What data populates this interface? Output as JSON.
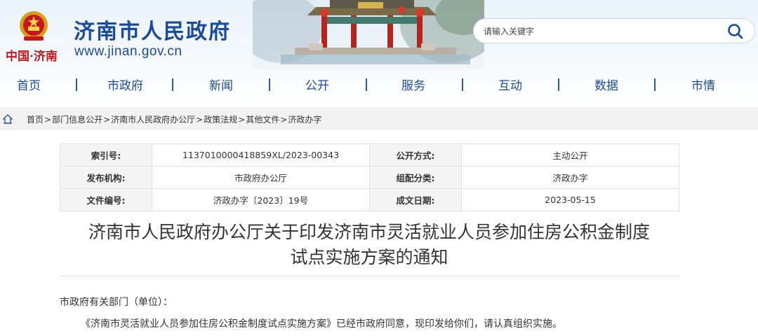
{
  "header": {
    "site_name": "济南市人民政府",
    "china_jinan": "中国·济南",
    "domain": "www.jinan.gov.cn",
    "search_placeholder": "请输入关键字"
  },
  "nav": {
    "items": [
      "首页",
      "市政府",
      "新闻",
      "公开",
      "服务",
      "互动",
      "数据",
      "市情"
    ]
  },
  "breadcrumb": [
    "首页",
    "部门信息公开",
    "济南市人民政府办公厅",
    "政策法规",
    "其他文件",
    "济政办字"
  ],
  "meta": {
    "index_no_label": "索引号:",
    "index_no": "1137010000418859XL/2023-00343",
    "publish_method_label": "公开方式:",
    "publish_method": "主动公开",
    "issuer_label": "发布机构:",
    "issuer": "市政府办公厅",
    "category_label": "组配分类:",
    "category": "济政办字",
    "doc_no_label": "文件编号:",
    "doc_no": "济政办字〔2023〕19号",
    "date_label": "成文日期:",
    "date": "2023-05-15"
  },
  "document": {
    "title_line1": "济南市人民政府办公厅关于印发济南市灵活就业人员参加住房公积金制度",
    "title_line2": "试点实施方案的通知",
    "addressee": "市政府有关部门（单位）：",
    "paragraph": "《济南市灵活就业人员参加住房公积金制度试点实施方案》已经市政府同意，现印发给你们，请认真组织实施。"
  },
  "colors": {
    "brand_blue": "#1a4a9c",
    "red": "#c8161d",
    "breadcrumb_bg": "#f2f2f2",
    "table_label_bg": "#f5f5f5"
  }
}
